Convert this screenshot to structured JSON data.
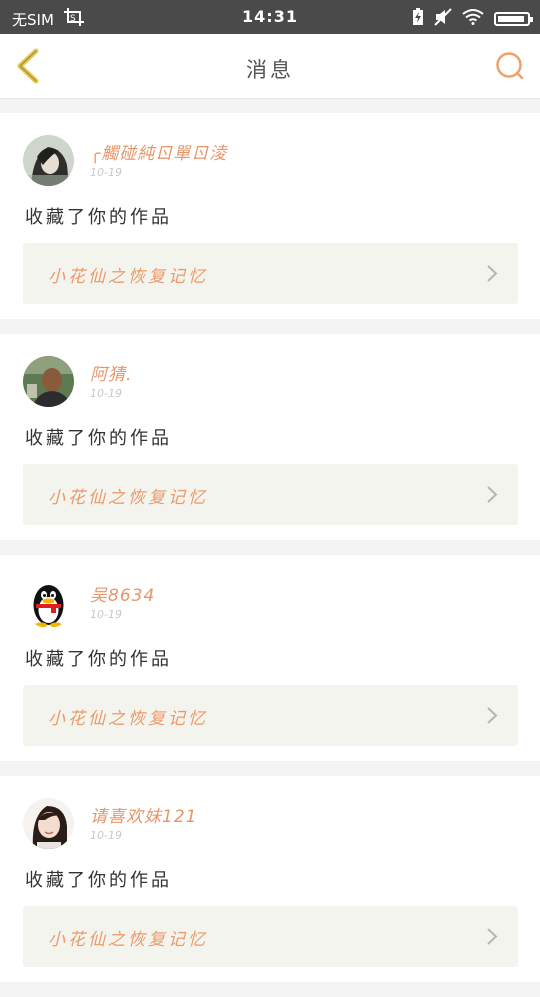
{
  "status_bar": {
    "carrier": "无SIM",
    "time": "14:31",
    "battery_level": 0.92,
    "icons": [
      "screenshot-icon",
      "charging-icon",
      "mute-icon",
      "wifi-icon",
      "battery-icon"
    ]
  },
  "nav": {
    "title": "消息",
    "back_icon": "chevron-left-icon",
    "search_icon": "search-icon",
    "accent": "#f0a06a",
    "back_color": "#e8c84a"
  },
  "messages": [
    {
      "user": "╭觸碰純ㄖ單ㄖ淩",
      "date": "10-19",
      "action": "收藏了你的作品",
      "work": "小花仙之恢复记忆",
      "avatar": "avatar-girl-hair"
    },
    {
      "user": "阿猜.",
      "date": "10-19",
      "action": "收藏了你的作品",
      "work": "小花仙之恢复记忆",
      "avatar": "avatar-man"
    },
    {
      "user": "吴8634",
      "date": "10-19",
      "action": "收藏了你的作品",
      "work": "小花仙之恢复记忆",
      "avatar": "avatar-qq-penguin"
    },
    {
      "user": "请喜欢妹121",
      "date": "10-19",
      "action": "收藏了你的作品",
      "work": "小花仙之恢复记忆",
      "avatar": "avatar-girl-face"
    }
  ]
}
